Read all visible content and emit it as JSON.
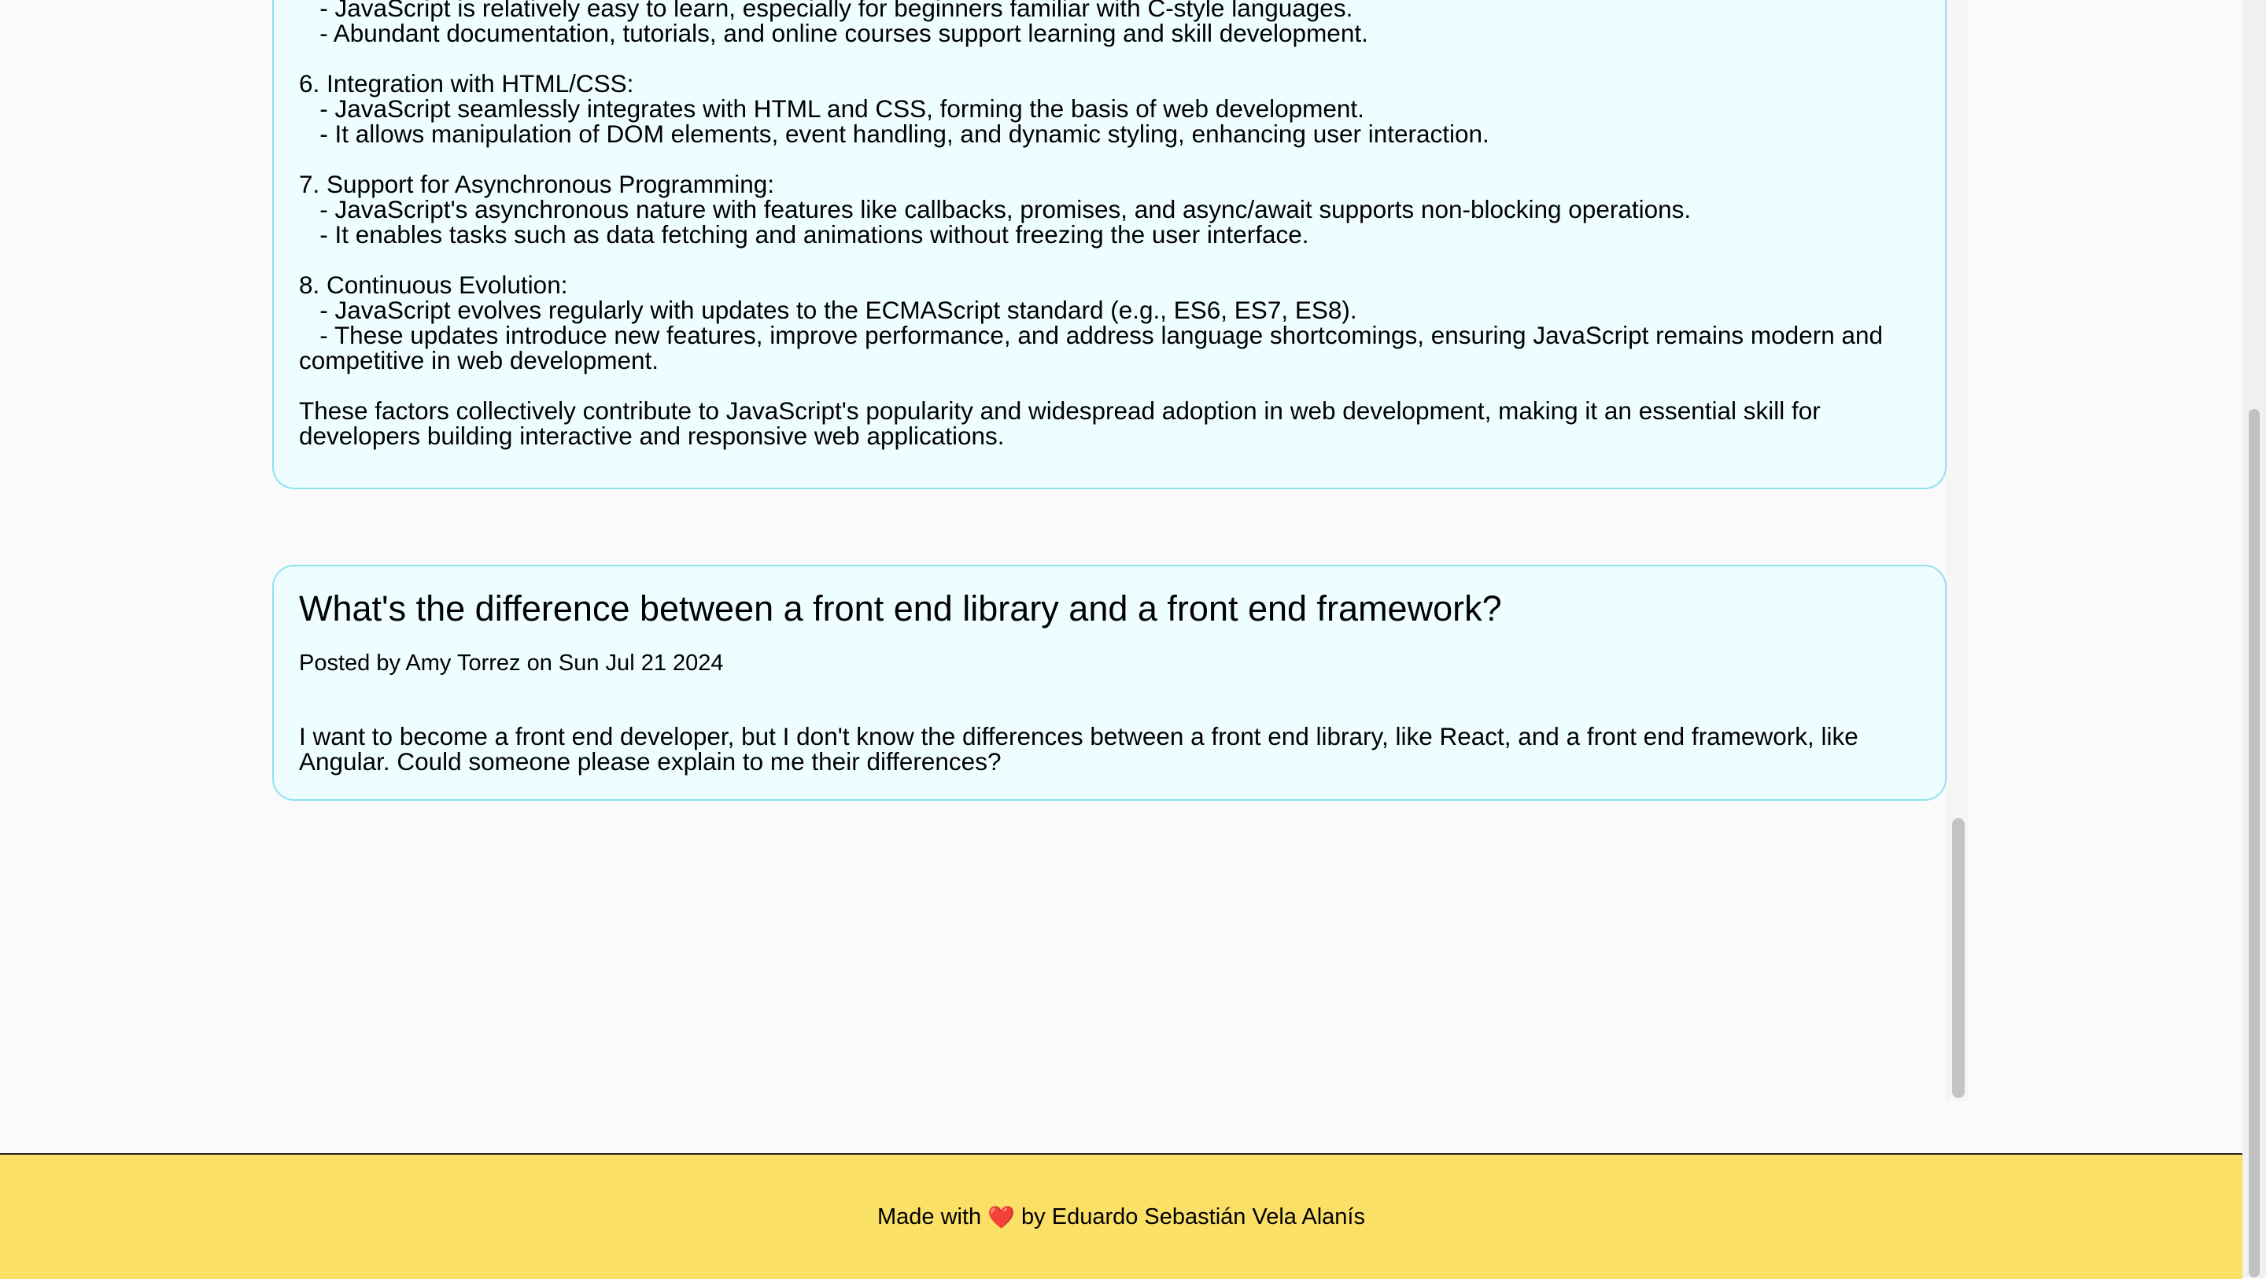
{
  "posts": [
    {
      "body": "   - JavaScript is relatively easy to learn, especially for beginners familiar with C-style languages.\n   - Abundant documentation, tutorials, and online courses support learning and skill development.\n\n6. Integration with HTML/CSS:\n   - JavaScript seamlessly integrates with HTML and CSS, forming the basis of web development.\n   - It allows manipulation of DOM elements, event handling, and dynamic styling, enhancing user interaction.\n\n7. Support for Asynchronous Programming:\n   - JavaScript's asynchronous nature with features like callbacks, promises, and async/await supports non-blocking operations.\n   - It enables tasks such as data fetching and animations without freezing the user interface.\n\n8. Continuous Evolution:\n   - JavaScript evolves regularly with updates to the ECMAScript standard (e.g., ES6, ES7, ES8).\n   - These updates introduce new features, improve performance, and address language shortcomings, ensuring JavaScript remains modern and competitive in web development.\n\nThese factors collectively contribute to JavaScript's popularity and widespread adoption in web development, making it an essential skill for developers building interactive and responsive web applications."
    },
    {
      "title": "What's the difference between a front end library and a front end framework?",
      "meta": "Posted by Amy Torrez on Sun Jul 21 2024",
      "body": "I want to become a front end developer, but I don't know the differences between a front end library, like React, and a front end framework, like Angular. Could someone please explain to me their differences?"
    }
  ],
  "footer": {
    "prefix": "Made with",
    "heart_icon": "heart-icon",
    "heart": "❤️",
    "suffix": "by Eduardo Sebastián Vela Alanís"
  },
  "colors": {
    "card_bg": "#eefdff",
    "card_border": "#8fe3ee",
    "footer_bg": "#fbe068"
  }
}
